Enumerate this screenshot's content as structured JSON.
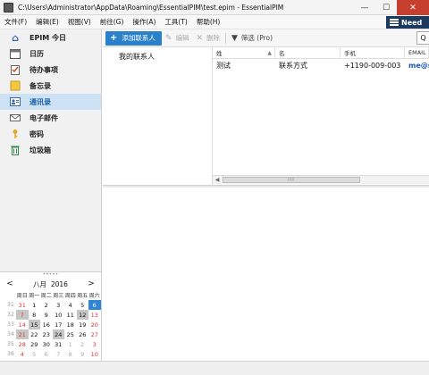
{
  "window": {
    "title": "C:\\Users\\Administrator\\AppData\\Roaming\\EssentialPIM\\test.epim - EssentialPIM",
    "minimize": "—",
    "maximize": "☐",
    "close": "✕"
  },
  "menu": {
    "items": [
      "文件(F)",
      "编辑(E)",
      "视图(V)",
      "前往(G)",
      "操作(A)",
      "工具(T)",
      "帮助(H)"
    ],
    "need_button": "Need"
  },
  "sidebar": {
    "items": [
      {
        "label": "EPIM 今日",
        "icon": "home-icon"
      },
      {
        "label": "日历",
        "icon": "calendar-icon"
      },
      {
        "label": "待办事项",
        "icon": "todo-icon"
      },
      {
        "label": "备忘录",
        "icon": "notes-icon"
      },
      {
        "label": "通讯录",
        "icon": "contacts-icon"
      },
      {
        "label": "电子邮件",
        "icon": "email-icon"
      },
      {
        "label": "密码",
        "icon": "key-icon"
      },
      {
        "label": "垃圾箱",
        "icon": "trash-icon"
      }
    ],
    "active": "通讯录"
  },
  "toolbar": {
    "add": "添加联系人",
    "edit": "编辑",
    "delete": "删除",
    "filter": "筛选 (Pro)",
    "search_glyph": "Q"
  },
  "groups": {
    "items": [
      "我的联系人"
    ]
  },
  "contacts": {
    "columns": [
      "姓",
      "名",
      "手机",
      "EMAIL"
    ],
    "rows": [
      {
        "last": "测试",
        "first": "联系方式",
        "mobile": "+1190-009-003",
        "email": "me@s"
      }
    ]
  },
  "scrollbar": {
    "grip": "III"
  },
  "calendar": {
    "grip": "•••••",
    "month": "八月",
    "year": "2016",
    "prev": "<",
    "next": ">",
    "dow": [
      "周日",
      "周一",
      "周二",
      "周三",
      "周四",
      "周五",
      "周六"
    ],
    "weeks": [
      {
        "wk": "31",
        "days": [
          "31",
          "1",
          "2",
          "3",
          "4",
          "5",
          "6"
        ]
      },
      {
        "wk": "32",
        "days": [
          "7",
          "8",
          "9",
          "10",
          "11",
          "12",
          "13"
        ]
      },
      {
        "wk": "33",
        "days": [
          "14",
          "15",
          "16",
          "17",
          "18",
          "19",
          "20"
        ]
      },
      {
        "wk": "34",
        "days": [
          "21",
          "22",
          "23",
          "24",
          "25",
          "26",
          "27"
        ]
      },
      {
        "wk": "35",
        "days": [
          "28",
          "29",
          "30",
          "31",
          "1",
          "2",
          "3"
        ]
      },
      {
        "wk": "36",
        "days": [
          "4",
          "5",
          "6",
          "7",
          "8",
          "9",
          "10"
        ]
      }
    ],
    "today": "6",
    "colors": {
      "weekend": "#dd3333",
      "today_bg": "#2f86d6",
      "highlight_bg": "#c6c6c6"
    }
  },
  "colors": {
    "accent": "#2a80c9",
    "active_bg": "#cde3f5",
    "close_red": "#c7402f",
    "need_bg": "#1c3a5e"
  }
}
